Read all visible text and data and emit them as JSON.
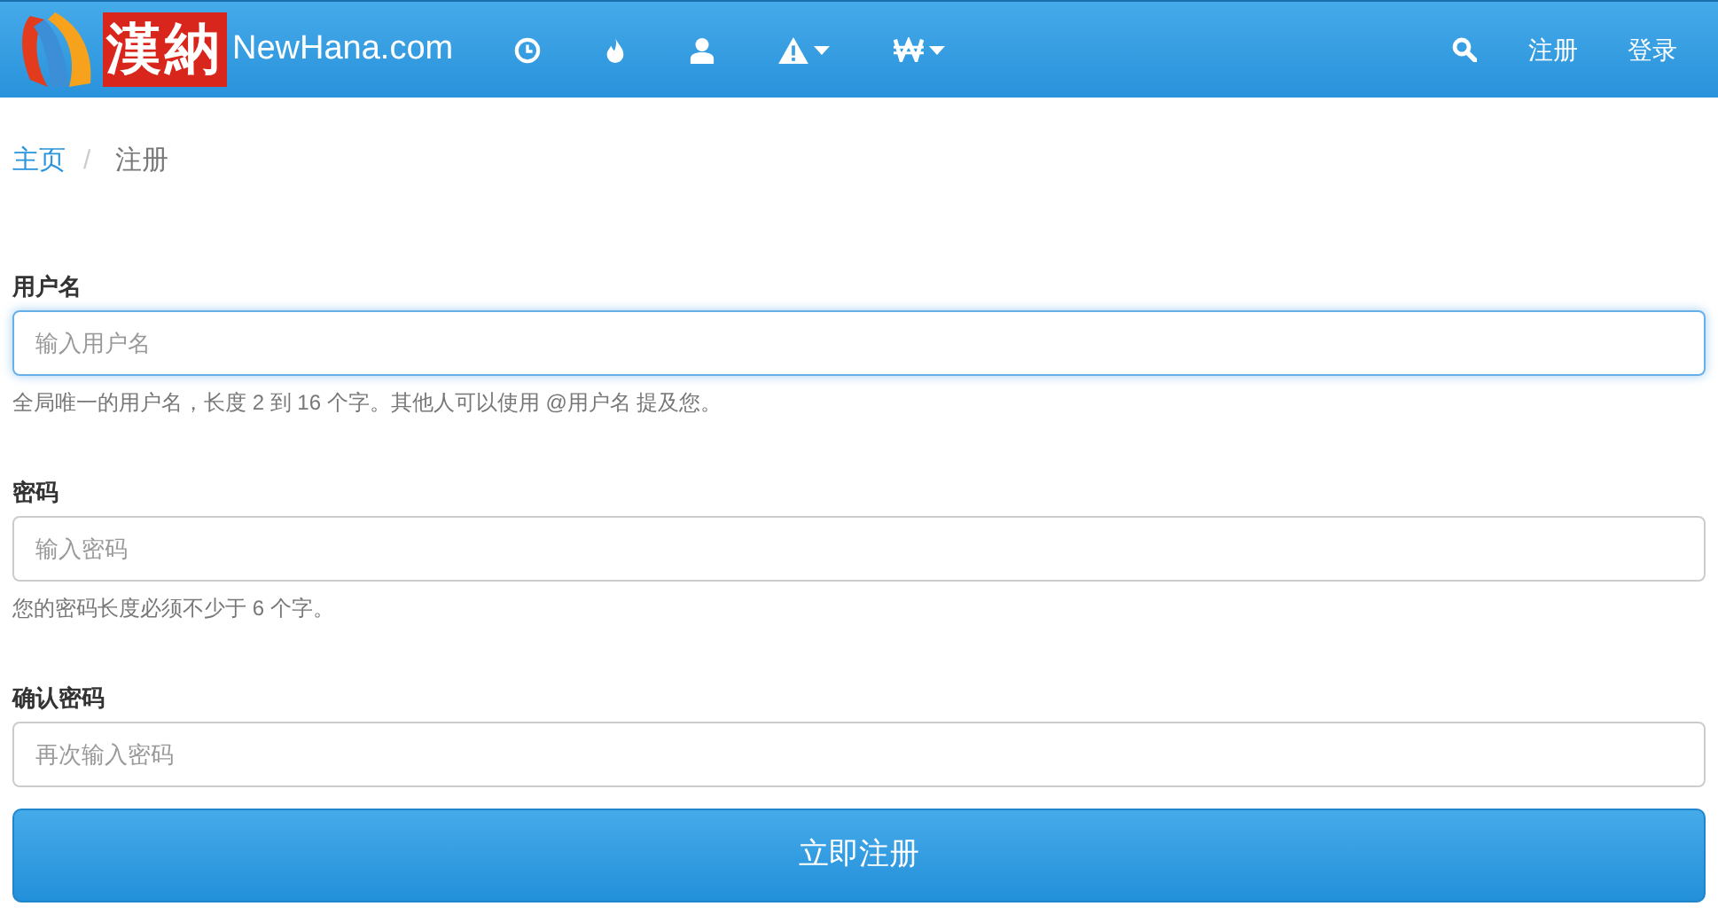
{
  "navbar": {
    "logo_text": "漢納",
    "brand": "NewHana.com",
    "items": [
      {
        "kind": "clock",
        "dropdown": false
      },
      {
        "kind": "flame",
        "dropdown": false
      },
      {
        "kind": "user",
        "dropdown": false
      },
      {
        "kind": "warning",
        "dropdown": true
      },
      {
        "kind": "won",
        "dropdown": true
      }
    ],
    "links": [
      "注册",
      "登录"
    ]
  },
  "breadcrumb": [
    {
      "label": "主页",
      "link": true
    },
    {
      "label": "注册",
      "link": false
    }
  ],
  "separator": "/",
  "fields": [
    {
      "label": "用户名",
      "placeholder": "输入用户名",
      "focused": true,
      "help": "全局唯一的用户名，长度 2 到 16 个字。其他人可以使用 @用户名 提及您。"
    },
    {
      "label": "密码",
      "placeholder": "输入密码",
      "focused": false,
      "help": "您的密码长度必须不少于 6 个字。"
    },
    {
      "label": "确认密码",
      "placeholder": "再次输入密码",
      "focused": false
    }
  ],
  "submit": "立即注册"
}
